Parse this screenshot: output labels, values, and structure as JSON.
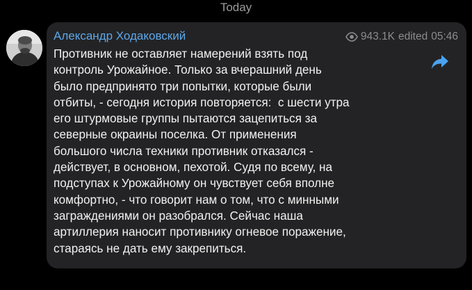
{
  "date_separator": "Today",
  "message": {
    "sender": "Александр Ходаковский",
    "views": "943.1K",
    "edited_label": "edited",
    "time": "05:46",
    "lines": [
      "Противник не оставляет намерений взять под",
      "контроль Урожайное. Только за вчерашний день",
      "было предпринято три попытки, которые были",
      "отбиты, - сегодня история повторяется:  с шести утра",
      "его штурмовые группы пытаются зацепиться за",
      "северные окраины поселка. От применения",
      "большого числа техники противник отказался -",
      "действует, в основном, пехотой. Судя по всему, на",
      "подступах к Урожайному он чувствует себя вполне",
      "комфортно, - что говорит нам о том, что с минными",
      "заграждениями он разобрался. Сейчас наша",
      "артиллерия наносит противнику огневое поражение,",
      "стараясь не дать ему закрепиться."
    ]
  },
  "icons": {
    "views": "eye-icon",
    "share": "share-arrow-icon",
    "avatar": "avatar"
  },
  "colors": {
    "background": "#000000",
    "bubble": "#232325",
    "sender": "#5ea7e9",
    "text": "#f1f1f1",
    "meta": "#8c8c8e",
    "share": "#4aa3f0"
  }
}
